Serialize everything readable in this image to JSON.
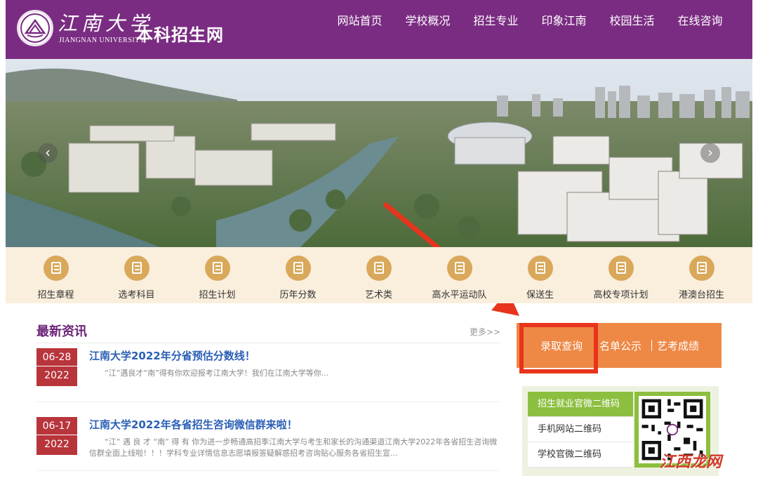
{
  "header": {
    "logo_cn": "江南大学",
    "logo_en": "JIANGNAN UNIVERSITY",
    "site_title": "本科招生网",
    "nav": [
      "网站首页",
      "学校概况",
      "招生专业",
      "印象江南",
      "校园生活",
      "在线咨询"
    ]
  },
  "banner": {
    "prev": "‹",
    "next": "›"
  },
  "categories": [
    "招生章程",
    "选考科目",
    "招生计划",
    "历年分数",
    "艺术类",
    "高水平运动队",
    "保送生",
    "高校专项计划",
    "港澳台招生"
  ],
  "news": {
    "title": "最新资讯",
    "more": "更多>>",
    "items": [
      {
        "month_day": "06-28",
        "year": "2022",
        "headline": "江南大学2022年分省预估分数线！",
        "summary": "“江”遇良才“南”得有你欢迎报考江南大学！我们在江南大学等你..."
      },
      {
        "month_day": "06-17",
        "year": "2022",
        "headline": "江南大学2022年各省招生咨询微信群来啦！",
        "summary": "“江” 遇 良 才 “南” 得 有 你为进一步畅通高招季江南大学与考生和家长的沟通渠道江南大学2022年各省招生咨询微信群全面上线啦！！！学科专业详情信息志愿填报答疑解惑招考咨询贴心服务各省招生宣..."
      }
    ]
  },
  "query": {
    "tabs": [
      "录取查询",
      "名单公示",
      "艺考成绩"
    ]
  },
  "qr": {
    "tabs": [
      "招生就业官微二维码",
      "手机网站二维码",
      "学校官微二维码"
    ]
  },
  "watermark": "江西龙网",
  "colors": {
    "header": "#7a2c82",
    "date_box": "#b8353b",
    "query_bar": "#ee8845",
    "highlight": "#e8341c",
    "qr_green": "#8cbf3f"
  }
}
